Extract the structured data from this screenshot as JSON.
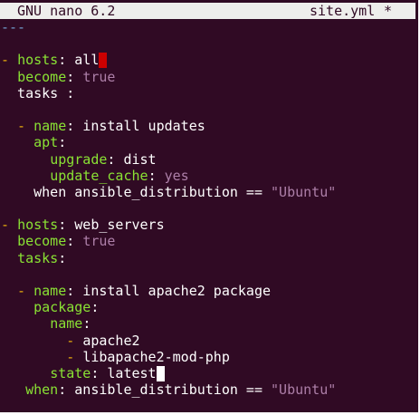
{
  "titlebar": {
    "app": "GNU nano 6.2",
    "filename": "site.yml",
    "modified": "*"
  },
  "colors": {
    "background": "#300a24",
    "titlebar_bg": "#eeeeec",
    "key": "#8ae234",
    "value": "#ad7fa8",
    "dash": "#e9ad0c",
    "doc_marker": "#729fcf",
    "cursor_error": "#cc0000",
    "cursor_main": "#ffffff"
  },
  "lines": [
    [
      {
        "t": "---",
        "c": "doc"
      }
    ],
    [],
    [
      {
        "t": "- ",
        "c": "dash"
      },
      {
        "t": "hosts",
        "c": "key"
      },
      {
        "t": ": all",
        "c": "plain"
      },
      {
        "cursor": "red"
      }
    ],
    [
      {
        "t": "  ",
        "c": "plain"
      },
      {
        "t": "become",
        "c": "key"
      },
      {
        "t": ": ",
        "c": "plain"
      },
      {
        "t": "true",
        "c": "value"
      }
    ],
    [
      {
        "t": "  tasks :",
        "c": "plain"
      }
    ],
    [],
    [
      {
        "t": "  - ",
        "c": "dash"
      },
      {
        "t": "name",
        "c": "key"
      },
      {
        "t": ": install updates",
        "c": "plain"
      }
    ],
    [
      {
        "t": "    ",
        "c": "plain"
      },
      {
        "t": "apt",
        "c": "key"
      },
      {
        "t": ":",
        "c": "plain"
      }
    ],
    [
      {
        "t": "      ",
        "c": "plain"
      },
      {
        "t": "upgrade",
        "c": "key"
      },
      {
        "t": ": dist",
        "c": "plain"
      }
    ],
    [
      {
        "t": "      ",
        "c": "plain"
      },
      {
        "t": "update_cache",
        "c": "key"
      },
      {
        "t": ": ",
        "c": "plain"
      },
      {
        "t": "yes",
        "c": "value"
      }
    ],
    [
      {
        "t": "    when ansible_distribution == ",
        "c": "plain"
      },
      {
        "t": "\"Ubuntu\"",
        "c": "string"
      }
    ],
    [],
    [
      {
        "t": "- ",
        "c": "dash"
      },
      {
        "t": "hosts",
        "c": "key"
      },
      {
        "t": ": web_servers",
        "c": "plain"
      }
    ],
    [
      {
        "t": "  ",
        "c": "plain"
      },
      {
        "t": "become",
        "c": "key"
      },
      {
        "t": ": ",
        "c": "plain"
      },
      {
        "t": "true",
        "c": "value"
      }
    ],
    [
      {
        "t": "  ",
        "c": "plain"
      },
      {
        "t": "tasks",
        "c": "key"
      },
      {
        "t": ":",
        "c": "plain"
      }
    ],
    [],
    [
      {
        "t": "  - ",
        "c": "dash"
      },
      {
        "t": "name",
        "c": "key"
      },
      {
        "t": ": install apache2 package",
        "c": "plain"
      }
    ],
    [
      {
        "t": "    ",
        "c": "plain"
      },
      {
        "t": "package",
        "c": "key"
      },
      {
        "t": ":",
        "c": "plain"
      }
    ],
    [
      {
        "t": "      ",
        "c": "plain"
      },
      {
        "t": "name",
        "c": "key"
      },
      {
        "t": ":",
        "c": "plain"
      }
    ],
    [
      {
        "t": "        - ",
        "c": "dash"
      },
      {
        "t": "apache2",
        "c": "plain"
      }
    ],
    [
      {
        "t": "        - ",
        "c": "dash"
      },
      {
        "t": "libapache2-mod-php",
        "c": "plain"
      }
    ],
    [
      {
        "t": "      ",
        "c": "plain"
      },
      {
        "t": "state",
        "c": "key"
      },
      {
        "t": ": latest",
        "c": "plain"
      },
      {
        "cursor": "white"
      }
    ],
    [
      {
        "t": "   ",
        "c": "plain"
      },
      {
        "t": "when",
        "c": "key"
      },
      {
        "t": ": ansible_distribution == ",
        "c": "plain"
      },
      {
        "t": "\"Ubuntu\"",
        "c": "string"
      }
    ]
  ]
}
